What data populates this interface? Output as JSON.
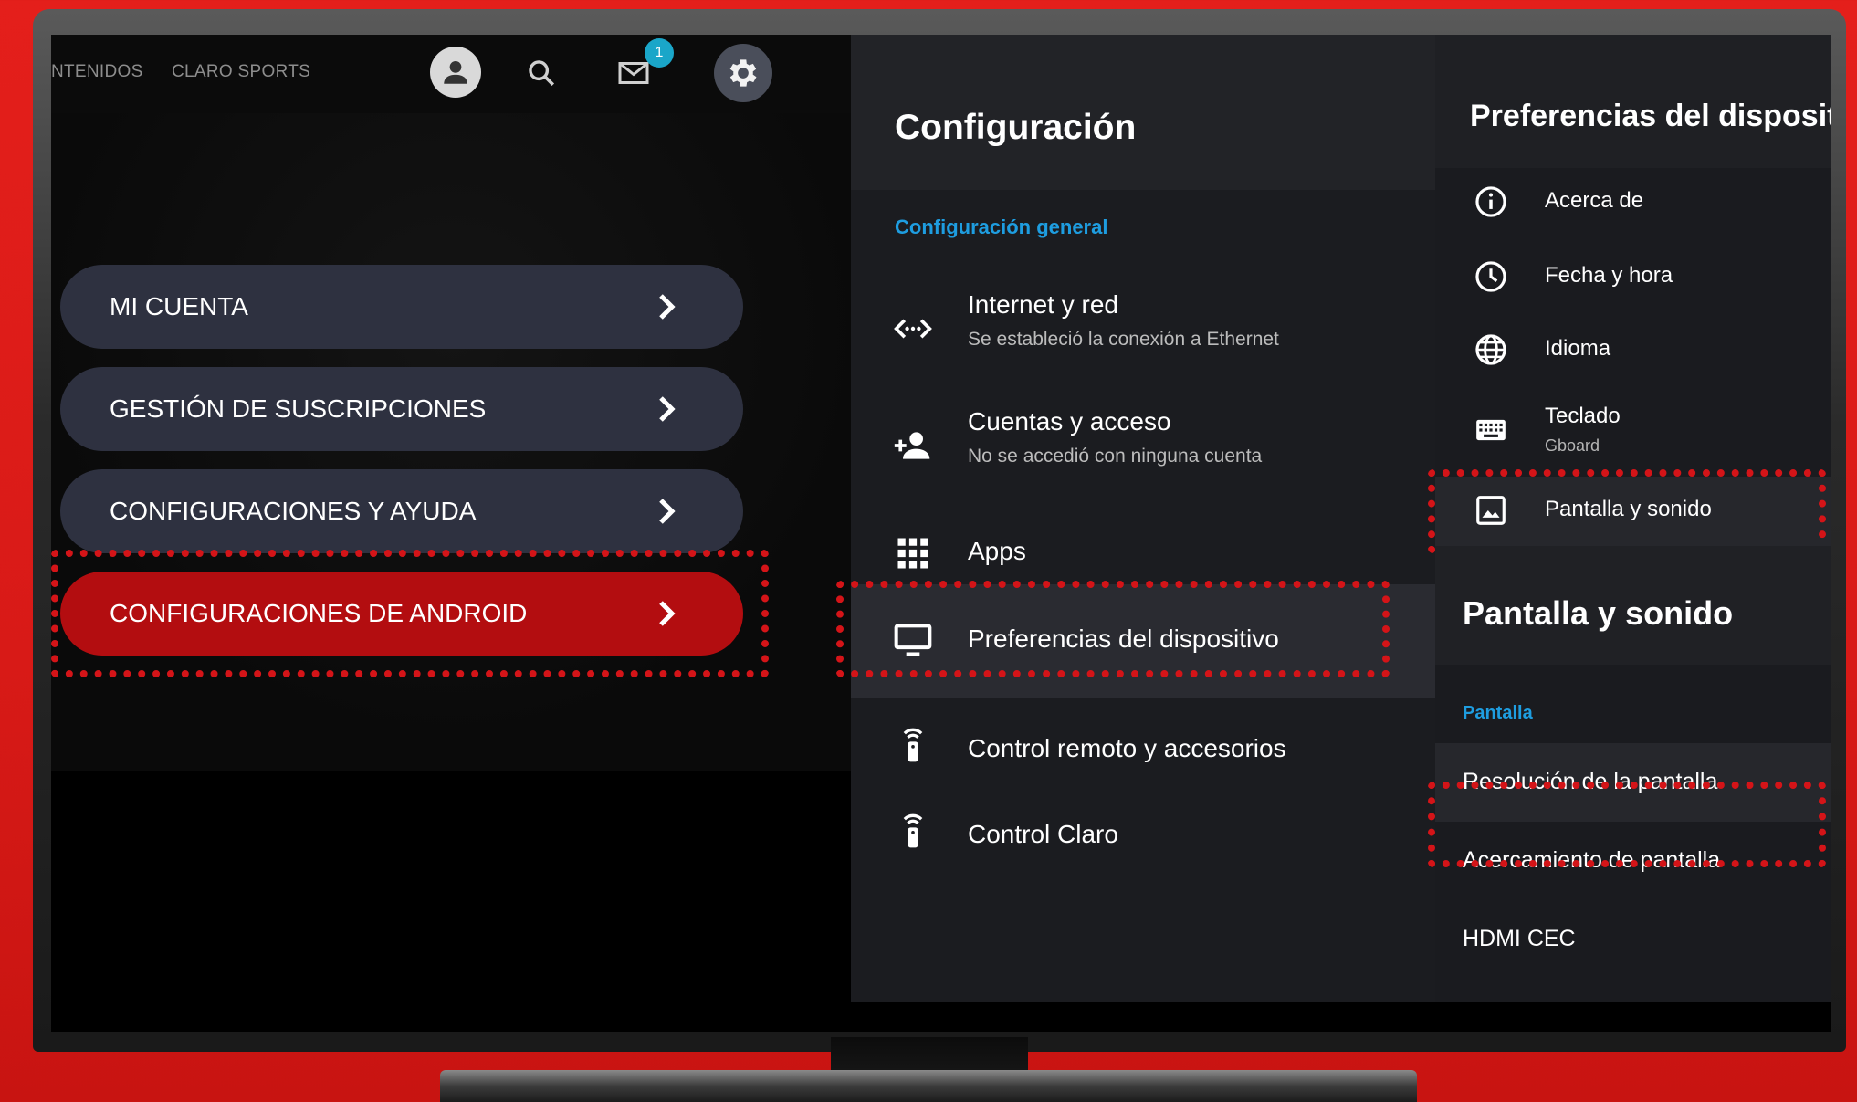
{
  "topbar": {
    "links": [
      "NTENIDOS",
      "CLARO SPORTS"
    ],
    "notification_count": "1",
    "icons": [
      "user-icon",
      "search-icon",
      "mail-icon",
      "gear-icon"
    ]
  },
  "account_menu": {
    "items": [
      {
        "label": "MI CUENTA"
      },
      {
        "label": "GESTIÓN DE SUSCRIPCIONES"
      },
      {
        "label": "CONFIGURACIONES Y AYUDA"
      },
      {
        "label": "CONFIGURACIONES DE ANDROID"
      }
    ],
    "active_index": 3
  },
  "settings": {
    "title": "Configuración",
    "section": "Configuración general",
    "rows": [
      {
        "title": "Internet y red",
        "subtitle": "Se estableció la conexión a Ethernet",
        "icon": "network-icon"
      },
      {
        "title": "Cuentas y acceso",
        "subtitle": "No se accedió con ninguna cuenta",
        "icon": "add-person-icon"
      },
      {
        "title": "Apps",
        "icon": "apps-grid-icon"
      },
      {
        "title": "Preferencias del dispositivo",
        "icon": "tv-icon"
      },
      {
        "title": "Control remoto y accesorios",
        "icon": "remote-icon"
      },
      {
        "title": "Control Claro",
        "icon": "remote-icon"
      }
    ]
  },
  "device_prefs": {
    "title": "Preferencias del dispositi",
    "rows": [
      {
        "title": "Acerca de",
        "icon": "info-icon"
      },
      {
        "title": "Fecha y hora",
        "icon": "clock-icon"
      },
      {
        "title": "Idioma",
        "icon": "globe-icon"
      },
      {
        "title": "Teclado",
        "subtitle": "Gboard",
        "icon": "keyboard-icon"
      },
      {
        "title": "Pantalla y sonido",
        "icon": "image-icon"
      }
    ]
  },
  "display_sound": {
    "title": "Pantalla y sonido",
    "section": "Pantalla",
    "items": [
      "Resolución de la pantalla",
      "Acercamiento de pantalla",
      "HDMI CEC"
    ]
  },
  "colors": {
    "background_red": "#e41f1b",
    "highlight_dotted": "#d41418",
    "active_button": "#b30d10",
    "section_blue": "#1e9de0"
  }
}
